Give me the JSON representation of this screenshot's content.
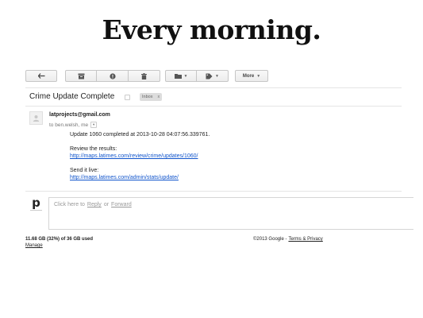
{
  "slide": {
    "title": "Every morning."
  },
  "toolbar": {
    "more_label": "More",
    "icons": [
      "back-arrow-icon",
      "archive-icon",
      "report-spam-icon",
      "trash-icon",
      "folder-icon",
      "label-tag-icon"
    ]
  },
  "thread": {
    "subject": "Crime Update Complete",
    "label": "Inbox",
    "label_remove": "x"
  },
  "message": {
    "from": "latprojects@gmail.com",
    "to": "to ben.welsh, me",
    "line1": "Update 1060 completed at 2013-10-28 04:07:56.339761.",
    "review_label": "Review the results:",
    "review_link": "http://maps.latimes.com/review/crime/updates/1060/",
    "live_label": "Send it live:",
    "live_link": "http://maps.latimes.com/admin/stats/update/"
  },
  "reply": {
    "avatar_letter": "p",
    "hint_prefix": "Click here to",
    "reply_link": "Reply",
    "hint_or": "or",
    "forward_link": "Forward"
  },
  "footer": {
    "storage": "11.68 GB (32%) of 36 GB used",
    "manage": "Manage",
    "copyright": "©2013 Google -",
    "terms": "Terms & Privacy"
  }
}
